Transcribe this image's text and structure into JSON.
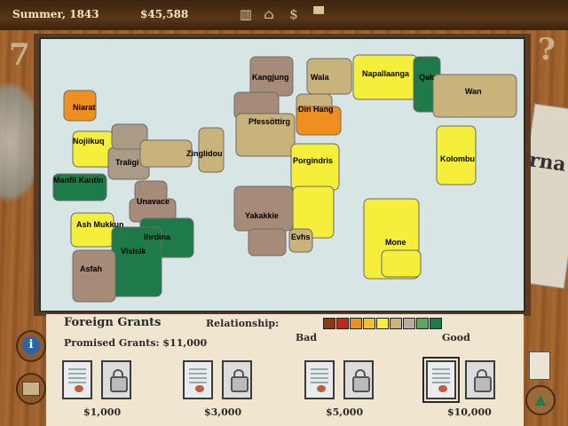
{
  "header": {
    "season": "Summer, 1843",
    "money": "$45,588",
    "icons": [
      "warehouse-icon",
      "capitol-icon",
      "dollar-icon",
      "hat-icon"
    ]
  },
  "map": {
    "regions": [
      {
        "name": "Niarat",
        "color": "#ee8f1f"
      },
      {
        "name": "Nojiikuq",
        "color": "#f5ee3a"
      },
      {
        "name": "Traligi",
        "color": "#ab9a85"
      },
      {
        "name": "Manfil Kantin",
        "color": "#1f7a4a"
      },
      {
        "name": "Zinglidou",
        "color": "#c9b37b"
      },
      {
        "name": "Kangjung",
        "color": "#a58b78"
      },
      {
        "name": "Wala",
        "color": "#c9b37b"
      },
      {
        "name": "Napallaanga",
        "color": "#f5ee3a"
      },
      {
        "name": "Qak",
        "color": "#1f7a4a"
      },
      {
        "name": "Wan",
        "color": "#c9b37b"
      },
      {
        "name": "Pfessöttirg",
        "color": "#c9b37b"
      },
      {
        "name": "Din Hang",
        "color": "#ee8f1f"
      },
      {
        "name": "Kolombu",
        "color": "#f5ee3a"
      },
      {
        "name": "Porgindris",
        "color": "#f5ee3a"
      },
      {
        "name": "Unavace",
        "color": "#a58b78"
      },
      {
        "name": "Ash Mukkun",
        "color": "#f5ee3a"
      },
      {
        "name": "Ihrdina",
        "color": "#1f7a4a"
      },
      {
        "name": "Visisik",
        "color": "#1f7a4a"
      },
      {
        "name": "Asfah",
        "color": "#a58b78"
      },
      {
        "name": "Yakakkie",
        "color": "#a58b78"
      },
      {
        "name": "Evhs",
        "color": "#c9b37b"
      },
      {
        "name": "Mone",
        "color": "#f5ee3a"
      }
    ]
  },
  "grants": {
    "title": "Foreign Grants",
    "promised": "Promised Grants: $11,000",
    "relationship_label": "Relationship:",
    "bad_label": "Bad",
    "good_label": "Good",
    "scale_colors": [
      "#8a3a14",
      "#c4261a",
      "#ee8f1f",
      "#f2c12a",
      "#f5ee3a",
      "#c9b37b",
      "#b9ad9a",
      "#5fa85a",
      "#1f7a4a"
    ],
    "options": [
      {
        "price": "$1,000",
        "selected": false
      },
      {
        "price": "$3,000",
        "selected": false
      },
      {
        "price": "$5,000",
        "selected": false
      },
      {
        "price": "$10,000",
        "selected": true
      }
    ]
  }
}
